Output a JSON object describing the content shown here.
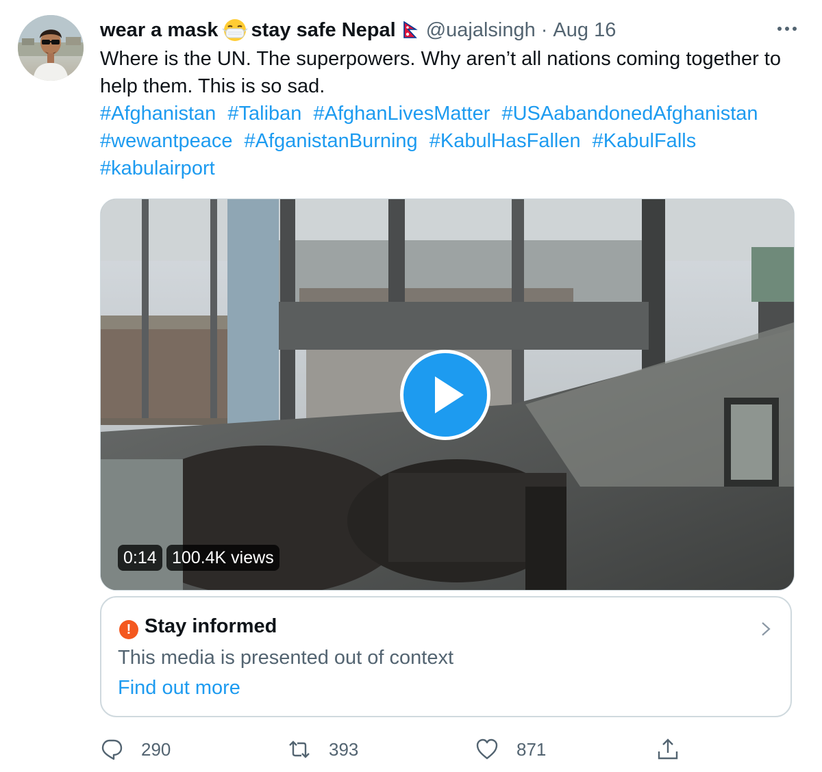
{
  "tweet": {
    "display_name_part1": "wear a mask",
    "display_name_part2": "stay safe Nepal",
    "emoji_icon": "face-with-medical-mask-emoji",
    "flag_icon": "nepal-flag-emoji",
    "handle": "@uajalsingh",
    "separator": "·",
    "date": "Aug 16",
    "text": "Where is the UN. The superpowers. Why aren’t all nations coming together to help them. This is so sad.",
    "hashtags": [
      "#Afghanistan",
      "#Taliban",
      "#AfghanLivesMatter",
      "#USAabandonedAfghanistan",
      "#wewantpeace",
      "#AfganistanBurning",
      "#KabulHasFallen",
      "#KabulFalls",
      "#kabulairport"
    ]
  },
  "video": {
    "duration": "0:14",
    "views": "100.4K views"
  },
  "notice": {
    "title": "Stay informed",
    "subtitle": "This media is presented out of context",
    "link": "Find out more"
  },
  "actions": {
    "replies": "290",
    "retweets": "393",
    "likes": "871"
  },
  "colors": {
    "accent": "#1d9bf0",
    "secondary_text": "#536471",
    "warning": "#f4581f",
    "border": "#cfd9de"
  }
}
